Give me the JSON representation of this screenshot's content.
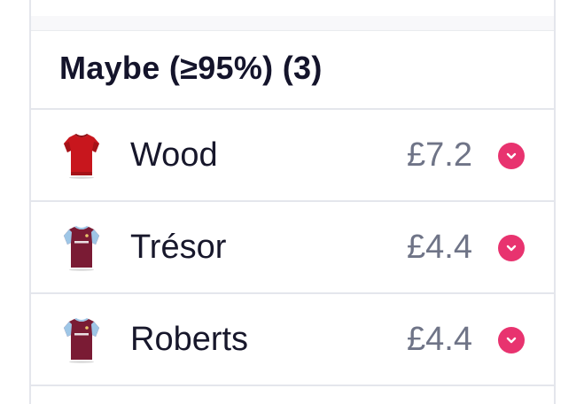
{
  "section": {
    "title": "Maybe (≥95%) (3)"
  },
  "players": [
    {
      "name": "Wood",
      "price": "£7.2",
      "shirt_icon": "red-shirt-icon",
      "shirt_color": "#c8161d",
      "sleeve_color": "#c8161d"
    },
    {
      "name": "Trésor",
      "price": "£4.4",
      "shirt_icon": "claret-blue-shirt-icon",
      "shirt_color": "#7a1b34",
      "sleeve_color": "#9ec6e6"
    },
    {
      "name": "Roberts",
      "price": "£4.4",
      "shirt_icon": "claret-blue-shirt-icon",
      "shirt_color": "#7a1b34",
      "sleeve_color": "#9ec6e6"
    }
  ],
  "colors": {
    "accent": "#e8336f",
    "title": "#14142b",
    "price": "#6f7487",
    "divider": "#e4e6ec"
  },
  "icons": {
    "expand": "chevron-down-icon"
  }
}
